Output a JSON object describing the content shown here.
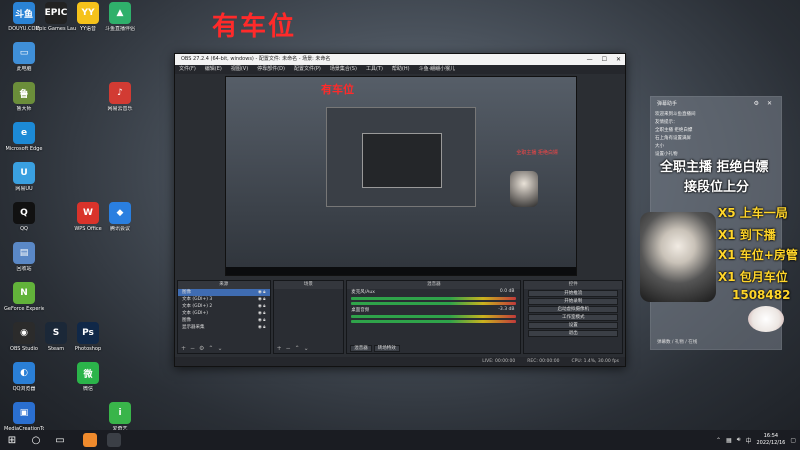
{
  "banner_text": "有车位",
  "desktop_icons": [
    {
      "label": "DOUYU.COM",
      "glyph": "斗鱼",
      "color": "#2a83d6",
      "col": 0,
      "row": 0
    },
    {
      "label": "Epic Games Launcher",
      "glyph": "EPIC",
      "color": "#222222",
      "col": 1,
      "row": 0
    },
    {
      "label": "YY语音",
      "glyph": "YY",
      "color": "#f5c21b",
      "col": 2,
      "row": 0
    },
    {
      "label": "斗鱼直播伴侣",
      "glyph": "▲",
      "color": "#2fb06b",
      "col": 3,
      "row": 0
    },
    {
      "label": "此电脑",
      "glyph": "▭",
      "color": "#3f8fd8",
      "col": 0,
      "row": 1
    },
    {
      "label": "鲁大师",
      "glyph": "鲁",
      "color": "#6b8e3a",
      "col": 0,
      "row": 2
    },
    {
      "label": "Microsoft Edge",
      "glyph": "e",
      "color": "#1c8ad6",
      "col": 0,
      "row": 3
    },
    {
      "label": "网易UU",
      "glyph": "U",
      "color": "#3aa0e0",
      "col": 0,
      "row": 4
    },
    {
      "label": "QQ",
      "glyph": "Q",
      "color": "#111111",
      "col": 0,
      "row": 5
    },
    {
      "label": "回收站",
      "glyph": "▤",
      "color": "#5a88c6",
      "col": 0,
      "row": 6
    },
    {
      "label": "GeForce Experience",
      "glyph": "N",
      "color": "#62b33a",
      "col": 0,
      "row": 7
    },
    {
      "label": "OBS Studio",
      "glyph": "◉",
      "color": "#2b2b2b",
      "col": 0,
      "row": 8
    },
    {
      "label": "QQ浏览器",
      "glyph": "◐",
      "color": "#2a7fd6",
      "col": 0,
      "row": 9
    },
    {
      "label": "MediaCreationTool",
      "glyph": "▣",
      "color": "#2a6fd0",
      "col": 0,
      "row": 10
    },
    {
      "label": "Photoshop",
      "glyph": "Ps",
      "color": "#102848",
      "col": 2,
      "row": 8
    },
    {
      "label": "微信",
      "glyph": "微",
      "color": "#2bb44a",
      "col": 2,
      "row": 9
    },
    {
      "label": "WPS Office",
      "glyph": "W",
      "color": "#d9332b",
      "col": 2,
      "row": 5
    },
    {
      "label": "网易云音乐",
      "glyph": "♪",
      "color": "#d23b33",
      "col": 3,
      "row": 2
    },
    {
      "label": "腾讯会议",
      "glyph": "◆",
      "color": "#2a7fe0",
      "col": 3,
      "row": 5
    },
    {
      "label": "Steam",
      "glyph": "S",
      "color": "#1b2838",
      "col": 1,
      "row": 8
    },
    {
      "label": "爱奇艺",
      "glyph": "i",
      "color": "#39b54a",
      "col": 3,
      "row": 10
    }
  ],
  "obs": {
    "title": "OBS 27.2.4 (64-bit, windows) - 配置文件: 未命名 - 场景: 未命名",
    "menu": [
      "文件(F)",
      "编辑(E)",
      "视图(V)",
      "停靠部件(D)",
      "配置文件(P)",
      "场景集合(S)",
      "工具(T)",
      "帮助(H)",
      "斗鱼·翩翩小猴儿"
    ],
    "preview_banner": "有车位",
    "preview_red_text": "全职主播 拒绝白嫖",
    "source_label": "未选择源",
    "tabs": {
      "scenes": "来源",
      "sources": "场景",
      "mixer": "混音器",
      "transitions": "转场特效",
      "controls": "控件"
    },
    "scene_items": [
      {
        "name": "图像",
        "selected": true
      },
      {
        "name": "文本 (GDI+) 3",
        "selected": false
      },
      {
        "name": "文本 (GDI+) 2",
        "selected": false
      },
      {
        "name": "文本 (GDI+)",
        "selected": false
      },
      {
        "name": "图像",
        "selected": false
      },
      {
        "name": "显示器采集",
        "selected": false
      }
    ],
    "mixer": [
      {
        "name": "麦克风/Aux",
        "db": "0.0 dB"
      },
      {
        "name": "桌面音频",
        "db": "-3.3 dB"
      }
    ],
    "mixer_tabs": [
      "混音器",
      "转场特效"
    ],
    "controls": [
      "开始推流",
      "开始录制",
      "启动虚拟摄像机",
      "工作室模式",
      "设置",
      "退出"
    ],
    "status": [
      "LIVE: 00:00:00",
      "REC: 00:00:00",
      "CPU: 1.4%, 30.00 fps"
    ]
  },
  "chat": {
    "header": "弹幕助手",
    "messages": [
      "欢迎来到斗鱼直播间",
      "友情提示：",
      "全职主播 拒绝白嫖",
      "石上角有设置满屏",
      "大小",
      "设置小礼物"
    ],
    "overlay_lines": [
      {
        "text": "全职主播 拒绝白嫖",
        "style": "white"
      },
      {
        "text": "接段位上分",
        "style": "white"
      },
      {
        "text": "X5 上车一局",
        "style": "yellow"
      },
      {
        "text": "X1 到下播",
        "style": "yellow"
      },
      {
        "text": "X1 车位+房管",
        "style": "yellow"
      },
      {
        "text": "X1 包月车位",
        "style": "yellow"
      },
      {
        "text": "1508482",
        "style": "yellow"
      }
    ],
    "footer": "弹幕数 / 礼物 / 在线"
  },
  "taskbar": {
    "apps": [
      {
        "name": "windows-start",
        "glyph": "⊞",
        "color": "#ffffff"
      },
      {
        "name": "search",
        "glyph": "○",
        "color": "#ffffff"
      },
      {
        "name": "task-view",
        "glyph": "▭",
        "color": "#ffffff"
      }
    ],
    "pinned": [
      {
        "name": "douyu-app",
        "color": "#f08b2d"
      },
      {
        "name": "obs-app",
        "color": "#3b3f46"
      }
    ],
    "time": "16:54",
    "date": "2022/12/16",
    "ime": "中"
  }
}
